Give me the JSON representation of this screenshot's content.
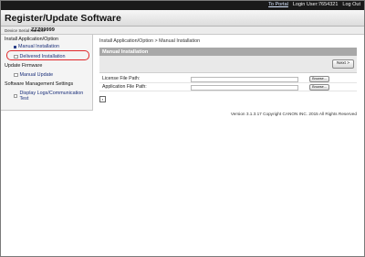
{
  "topbar": {
    "portal_link": "To Portal",
    "login_user": "Login User:7654321",
    "logout_link": "Log Out"
  },
  "header": {
    "title": "Register/Update Software"
  },
  "device": {
    "serial_label": "Device Serial Number",
    "serial_value": "ZZZ99999"
  },
  "sidebar": {
    "sections": [
      {
        "title": "Install Application/Option",
        "items": [
          "Manual Installation",
          "Delivered Installation"
        ]
      },
      {
        "title": "Update Firmware",
        "items": [
          "Manual Update"
        ]
      },
      {
        "title": "Software Management Settings",
        "items": [
          "Display Logs/Communication Test"
        ]
      }
    ],
    "highlight_color": "#e0292b"
  },
  "main": {
    "breadcrumb": "Install Application/Option > Manual Installation",
    "panel_title": "Manual Installation",
    "next_label": "Next >",
    "fields": [
      {
        "label": "License File Path:",
        "button": "Browse..."
      },
      {
        "label": "Application File Path:",
        "button": "Browse..."
      }
    ]
  },
  "footer": {
    "text": "Version 3.1.3.17 Copyright CANON INC. 2015 All Rights Reserved"
  }
}
